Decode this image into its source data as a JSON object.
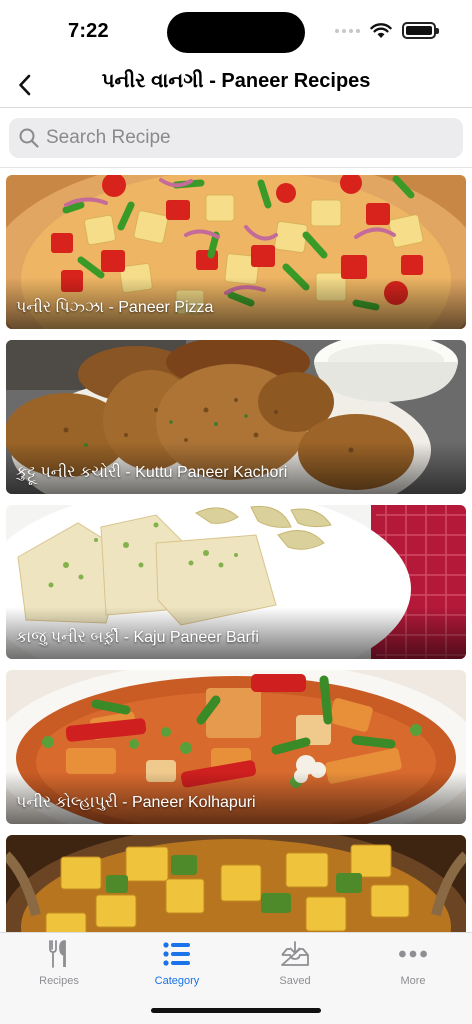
{
  "status_bar": {
    "time": "7:22"
  },
  "nav": {
    "title": "પનીર વાનગી - Paneer Recipes"
  },
  "search": {
    "placeholder": "Search Recipe"
  },
  "recipes": [
    {
      "label": "પનીર પિઝ્ઝા - Paneer Pizza",
      "image_icon": "paneer-pizza-image"
    },
    {
      "label": "કુટ્ટૂ પનીર કચોરી - Kuttu Paneer Kachori",
      "image_icon": "kuttu-paneer-kachori-image"
    },
    {
      "label": "કાજુ પનીર બર્ફી઼ - Kaju Paneer Barfi",
      "image_icon": "kaju-paneer-barfi-image"
    },
    {
      "label": "પનીર કોલ્હાપુરી - Paneer Kolhapuri",
      "image_icon": "paneer-kolhapuri-image"
    },
    {
      "label": "",
      "image_icon": "paneer-curry-image"
    }
  ],
  "tabs": [
    {
      "label": "Recipes",
      "icon": "fork-knife-icon",
      "active": false
    },
    {
      "label": "Category",
      "icon": "list-icon",
      "active": true
    },
    {
      "label": "Saved",
      "icon": "inbox-download-icon",
      "active": false
    },
    {
      "label": "More",
      "icon": "more-dots-icon",
      "active": false
    }
  ],
  "colors": {
    "accent": "#1a73e8",
    "inactive_tab": "#8e8e93",
    "search_bg": "#ececee"
  }
}
